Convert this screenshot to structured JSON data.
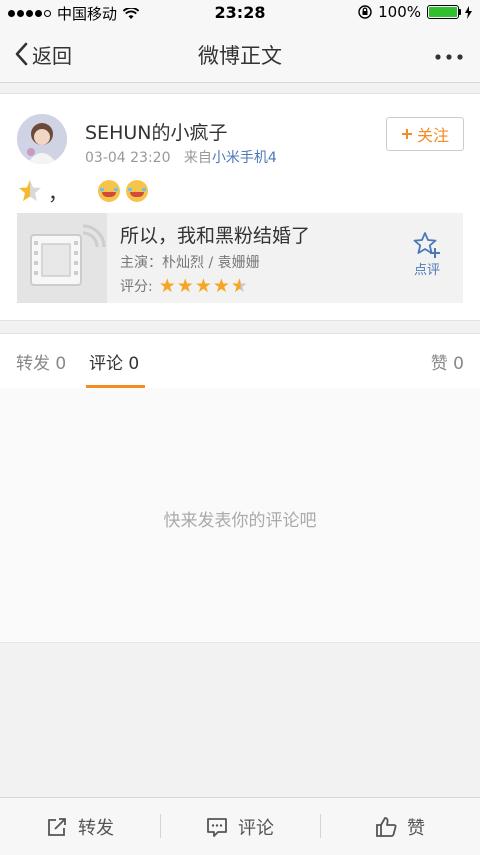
{
  "status_bar": {
    "carrier": "中国移动",
    "time": "23:28",
    "battery": "100%"
  },
  "nav": {
    "back_label": "返回",
    "title": "微博正文",
    "more_icon": "more-icon"
  },
  "post": {
    "username": "SEHUN的小疯子",
    "time": "03-04 23:20",
    "source_prefix": "来自",
    "source": "小米手机4",
    "follow_label": "关注",
    "content_text": "，"
  },
  "movie": {
    "title": "所以，我和黑粉结婚了",
    "cast_label": "主演：",
    "cast": "朴灿烈 / 袁姗姗",
    "rating_label": "评分:",
    "rating": 4.5,
    "rate_button": "点评"
  },
  "tabs": {
    "repost_label": "转发",
    "repost_count": "0",
    "comment_label": "评论",
    "comment_count": "0",
    "like_label": "赞",
    "like_count": "0"
  },
  "comments": {
    "empty_text": "快来发表你的评论吧"
  },
  "toolbar": {
    "repost": "转发",
    "comment": "评论",
    "like": "赞"
  },
  "colors": {
    "accent": "#f58b23",
    "link": "#4b79b8",
    "star": "#f5a623"
  }
}
